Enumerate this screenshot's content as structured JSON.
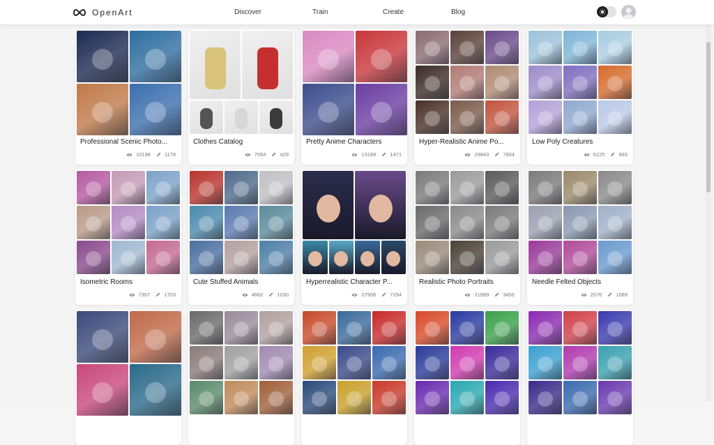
{
  "app": {
    "brand": "OpenArt"
  },
  "nav": {
    "items": [
      {
        "id": "discover",
        "label": "Discover"
      },
      {
        "id": "train",
        "label": "Train"
      },
      {
        "id": "create",
        "label": "Create"
      },
      {
        "id": "blog",
        "label": "Blog"
      }
    ]
  },
  "icons": {
    "logo": "infinity-icon",
    "theme": "sun-icon",
    "user": "user-avatar-icon",
    "views": "eye-icon",
    "uses": "pencil-icon"
  },
  "colors": {
    "accent_dark": "#1c1c1e",
    "card_bg": "#ffffff",
    "page_bg": "#f4f4f5"
  },
  "cards": [
    {
      "id": "scenic",
      "title": "Professional Scenic Photo...",
      "views": "10198",
      "uses": "1178",
      "layout": "grid2",
      "tiles": [
        "#1d2a52",
        "#2e6ea0",
        "#c07a4a",
        "#3b6fae"
      ]
    },
    {
      "id": "clothes",
      "title": "Clothes Catalog",
      "views": "7064",
      "uses": "429",
      "layout": "mixed",
      "tiles": [
        "#d9c37a",
        "#c5302f",
        "#545454",
        "#d7d7d7",
        "#3a3a3a",
        "#e6e6e6"
      ]
    },
    {
      "id": "anime",
      "title": "Pretty Anime Characters",
      "views": "13189",
      "uses": "1471",
      "layout": "grid2",
      "tiles": [
        "#d98ac2",
        "#c8373b",
        "#3c4d8c",
        "#6b3ea3"
      ]
    },
    {
      "id": "hyper-anime",
      "title": "Hyper-Realistic Anime Po...",
      "views": "29843",
      "uses": "7904",
      "layout": "grid3",
      "tiles": [
        "#8a6b74",
        "#5a4039",
        "#6a4b8a",
        "#3c2b25",
        "#b07a74",
        "#b08a72",
        "#4a3028",
        "#7a5a4a",
        "#c2543e"
      ]
    },
    {
      "id": "lowpoly",
      "title": "Low Poly Creatures",
      "views": "6225",
      "uses": "993",
      "layout": "grid3",
      "tiles": [
        "#9cc2d9",
        "#7fb5d6",
        "#a9cde0",
        "#9d8dc9",
        "#7e6fc0",
        "#d56b2c",
        "#b3a1d8",
        "#8fa9d0",
        "#b9c9e6"
      ]
    },
    {
      "id": "rooms",
      "title": "Isometric Rooms",
      "views": "7357",
      "uses": "1703",
      "layout": "grid3",
      "tiles": [
        "#b45aa0",
        "#c49ab4",
        "#7ca2c8",
        "#b89a88",
        "#b38bc4",
        "#7aa0c8",
        "#8a4a8c",
        "#a0b8d0",
        "#c46a90"
      ]
    },
    {
      "id": "stuffed",
      "title": "Cute Stuffed Animals",
      "views": "4662",
      "uses": "1030",
      "layout": "grid3",
      "tiles": [
        "#b9342c",
        "#4e6a8a",
        "#c0c0c4",
        "#4a8aac",
        "#5a7ab0",
        "#5a8a9a",
        "#4a6fa0",
        "#b4a0a0",
        "#4e7ea8"
      ]
    },
    {
      "id": "hyper-char",
      "title": "Hyperrealistic Character P...",
      "views": "27906",
      "uses": "7294",
      "layout": "mixed2",
      "tiles": [
        "#2a2c4c",
        "#6a4a8a",
        "#3a8aa8",
        "#5aa8c8",
        "#3a6a9a",
        "#2a4a6a"
      ]
    },
    {
      "id": "portraits",
      "title": "Realistic Photo Portraits",
      "views": "21989",
      "uses": "3456",
      "layout": "grid3",
      "tiles": [
        "#7a7a7a",
        "#9a9a9a",
        "#5a5a5a",
        "#6a6a6a",
        "#8a8a8a",
        "#7a7a7a",
        "#9a8a7a",
        "#4a4036",
        "#9a9a9a"
      ]
    },
    {
      "id": "felted",
      "title": "Needle Felted Objects",
      "views": "2576",
      "uses": "1089",
      "layout": "grid3",
      "tiles": [
        "#7a7a7a",
        "#9a8a6a",
        "#8a8a8a",
        "#9aa0b0",
        "#8a98b0",
        "#a0b0c8",
        "#9a3a9a",
        "#b04a9a",
        "#6a9ad0"
      ]
    },
    {
      "id": "landscapes",
      "title": "",
      "views": "",
      "uses": "",
      "layout": "grid2",
      "tiles": [
        "#3c4a7a",
        "#c06a4a",
        "#c8487a",
        "#2a6a8a"
      ]
    },
    {
      "id": "figurines",
      "title": "",
      "views": "",
      "uses": "",
      "layout": "grid3",
      "tiles": [
        "#6a6a6a",
        "#9a8a9a",
        "#b0a0a0",
        "#8a7a7a",
        "#a0a0a0",
        "#a08ab0",
        "#5a8a6a",
        "#c08a5a",
        "#a0603a"
      ]
    },
    {
      "id": "comics",
      "title": "",
      "views": "",
      "uses": "",
      "layout": "grid3",
      "tiles": [
        "#c84a2a",
        "#3a6a9a",
        "#c82a2a",
        "#d0a030",
        "#3a4a8a",
        "#3a6ab0",
        "#2a4a7a",
        "#c8a02a",
        "#c83a2a"
      ]
    },
    {
      "id": "psychedelic",
      "title": "",
      "views": "",
      "uses": "",
      "layout": "grid3",
      "tiles": [
        "#d84a2a",
        "#2a3aa0",
        "#3aa04a",
        "#2a3a9a",
        "#d03ab0",
        "#3a2a9a",
        "#6a2ab0",
        "#2aa8b0",
        "#4a2ab0"
      ]
    },
    {
      "id": "neon",
      "title": "",
      "views": "",
      "uses": "",
      "layout": "grid3",
      "tiles": [
        "#8a2ab0",
        "#d0404a",
        "#3a3ab0",
        "#3aa0d0",
        "#b03ab0",
        "#3aa0b0",
        "#3a2a8a",
        "#3a6ab0",
        "#6a3ab0"
      ]
    }
  ]
}
